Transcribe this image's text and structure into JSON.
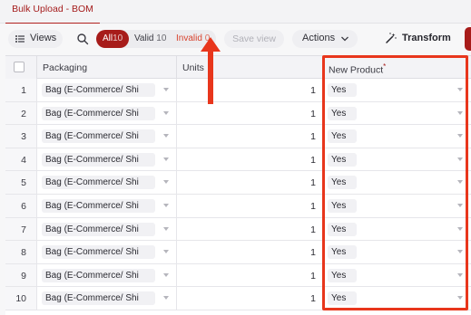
{
  "tabs": [
    {
      "label": "Bulk Upload - BOM",
      "active": true
    }
  ],
  "toolbar": {
    "views_label": "Views",
    "filters": {
      "all": {
        "label": "All",
        "count": "10"
      },
      "valid": {
        "label": "Valid",
        "count": "10"
      },
      "invalid": {
        "label": "Invalid",
        "count": "0"
      }
    },
    "save_view_label": "Save view",
    "actions_label": "Actions",
    "transform_label": "Transform"
  },
  "grid": {
    "columns": [
      {
        "label": "Packaging",
        "required": false
      },
      {
        "label": "Units",
        "required": false
      },
      {
        "label": "New Product",
        "required": true
      }
    ],
    "rows": [
      {
        "num": "1",
        "packaging": "Bag (E-Commerce/ Shi",
        "units": "1",
        "new_product": "Yes"
      },
      {
        "num": "2",
        "packaging": "Bag (E-Commerce/ Shi",
        "units": "1",
        "new_product": "Yes"
      },
      {
        "num": "3",
        "packaging": "Bag (E-Commerce/ Shi",
        "units": "1",
        "new_product": "Yes"
      },
      {
        "num": "4",
        "packaging": "Bag (E-Commerce/ Shi",
        "units": "1",
        "new_product": "Yes"
      },
      {
        "num": "5",
        "packaging": "Bag (E-Commerce/ Shi",
        "units": "1",
        "new_product": "Yes"
      },
      {
        "num": "6",
        "packaging": "Bag (E-Commerce/ Shi",
        "units": "1",
        "new_product": "Yes"
      },
      {
        "num": "7",
        "packaging": "Bag (E-Commerce/ Shi",
        "units": "1",
        "new_product": "Yes"
      },
      {
        "num": "8",
        "packaging": "Bag (E-Commerce/ Shi",
        "units": "1",
        "new_product": "Yes"
      },
      {
        "num": "9",
        "packaging": "Bag (E-Commerce/ Shi",
        "units": "1",
        "new_product": "Yes"
      },
      {
        "num": "10",
        "packaging": "Bag (E-Commerce/ Shi",
        "units": "1",
        "new_product": "Yes"
      }
    ]
  },
  "colors": {
    "brand": "#a71c1a",
    "annotation": "#e8361c",
    "invalid_text": "#d8432e"
  }
}
